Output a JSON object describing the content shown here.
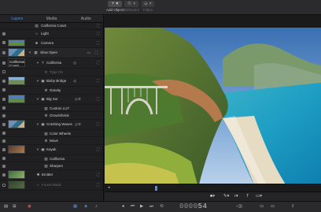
{
  "toolbar": {
    "add_object": {
      "icon": "plus-icon",
      "label": "Add Object"
    },
    "behaviors": {
      "icon": "gear-icon",
      "label": "Behaviors"
    },
    "filters": {
      "icon": "filter-icon",
      "label": "Filters"
    }
  },
  "panel": {
    "tabs": [
      {
        "label": "Layers",
        "active": true
      },
      {
        "label": "Media",
        "active": false
      },
      {
        "label": "Audio",
        "active": false
      }
    ],
    "layers": [
      {
        "name": "California Coast",
        "level": 0,
        "kind": "project"
      },
      {
        "name": "Light",
        "level": 1,
        "kind": "light"
      },
      {
        "name": "Camera",
        "level": 1,
        "kind": "camera"
      },
      {
        "name": "Slow Open",
        "level": 0,
        "kind": "group"
      },
      {
        "name": "California",
        "level": 1,
        "kind": "text"
      },
      {
        "name": "Type On",
        "level": 2,
        "kind": "behavior",
        "dim": true
      },
      {
        "name": "Bixby Bridge",
        "level": 1,
        "kind": "image"
      },
      {
        "name": "Gravity",
        "level": 2,
        "kind": "behavior"
      },
      {
        "name": "Big Sur",
        "level": 1,
        "kind": "image"
      },
      {
        "name": "Custom LUT",
        "level": 2,
        "kind": "filter"
      },
      {
        "name": "Grow/Shrink",
        "level": 2,
        "kind": "behavior"
      },
      {
        "name": "Crashing Waves",
        "level": 1,
        "kind": "image"
      },
      {
        "name": "Color Wheels",
        "level": 2,
        "kind": "filter"
      },
      {
        "name": "Move",
        "level": 2,
        "kind": "behavior"
      },
      {
        "name": "Kayak",
        "level": 1,
        "kind": "image"
      },
      {
        "name": "California",
        "level": 2,
        "kind": "filter"
      },
      {
        "name": "Sharpen",
        "level": 2,
        "kind": "filter"
      },
      {
        "name": "Emitter",
        "level": 1,
        "kind": "emitter"
      },
      {
        "name": "Forest Mask",
        "level": 1,
        "kind": "mask",
        "dim": true
      }
    ],
    "thumb_text": "California Coast"
  },
  "timecode": {
    "prefix": "0000",
    "value": "54"
  },
  "colors": {
    "accent": "#4a90e2",
    "record": "#d9534f"
  }
}
